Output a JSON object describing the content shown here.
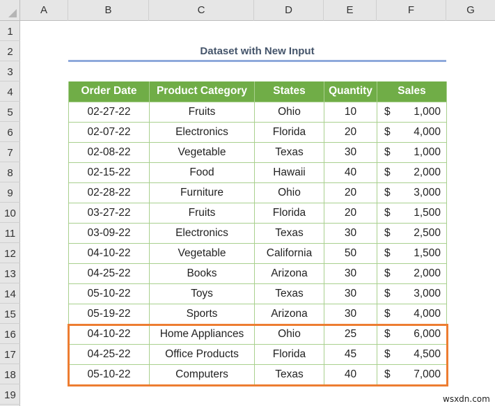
{
  "spreadsheet": {
    "columns": [
      "A",
      "B",
      "C",
      "D",
      "E",
      "F",
      "G"
    ],
    "rows": [
      "1",
      "2",
      "3",
      "4",
      "5",
      "6",
      "7",
      "8",
      "9",
      "10",
      "11",
      "12",
      "13",
      "14",
      "15",
      "16",
      "17",
      "18",
      "19"
    ]
  },
  "title": "Dataset with New Input",
  "table": {
    "headers": [
      "Order Date",
      "Product Category",
      "States",
      "Quantity",
      "Sales"
    ],
    "currency_symbol": "$",
    "rows": [
      {
        "date": "02-27-22",
        "category": "Fruits",
        "state": "Ohio",
        "qty": "10",
        "sales": "1,000"
      },
      {
        "date": "02-07-22",
        "category": "Electronics",
        "state": "Florida",
        "qty": "20",
        "sales": "4,000"
      },
      {
        "date": "02-08-22",
        "category": "Vegetable",
        "state": "Texas",
        "qty": "30",
        "sales": "1,000"
      },
      {
        "date": "02-15-22",
        "category": "Food",
        "state": "Hawaii",
        "qty": "40",
        "sales": "2,000"
      },
      {
        "date": "02-28-22",
        "category": "Furniture",
        "state": "Ohio",
        "qty": "20",
        "sales": "3,000"
      },
      {
        "date": "03-27-22",
        "category": "Fruits",
        "state": "Florida",
        "qty": "20",
        "sales": "1,500"
      },
      {
        "date": "03-09-22",
        "category": "Electronics",
        "state": "Texas",
        "qty": "30",
        "sales": "2,500"
      },
      {
        "date": "04-10-22",
        "category": "Vegetable",
        "state": "California",
        "qty": "50",
        "sales": "1,500"
      },
      {
        "date": "04-25-22",
        "category": "Books",
        "state": "Arizona",
        "qty": "30",
        "sales": "2,000"
      },
      {
        "date": "05-10-22",
        "category": "Toys",
        "state": "Texas",
        "qty": "30",
        "sales": "3,000"
      },
      {
        "date": "05-19-22",
        "category": "Sports",
        "state": "Arizona",
        "qty": "30",
        "sales": "4,000"
      },
      {
        "date": "04-10-22",
        "category": "Home Appliances",
        "state": "Ohio",
        "qty": "25",
        "sales": "6,000"
      },
      {
        "date": "04-25-22",
        "category": "Office Products",
        "state": "Florida",
        "qty": "45",
        "sales": "4,500"
      },
      {
        "date": "05-10-22",
        "category": "Computers",
        "state": "Texas",
        "qty": "40",
        "sales": "7,000"
      }
    ],
    "highlighted_rows": "16-18"
  },
  "colors": {
    "header_fill": "#70ad47",
    "cell_border": "#a9d08e",
    "title_text": "#44546a",
    "title_rule": "#8ea9db",
    "highlight_border": "#ed7d31"
  },
  "watermark": "wsxdn.com"
}
